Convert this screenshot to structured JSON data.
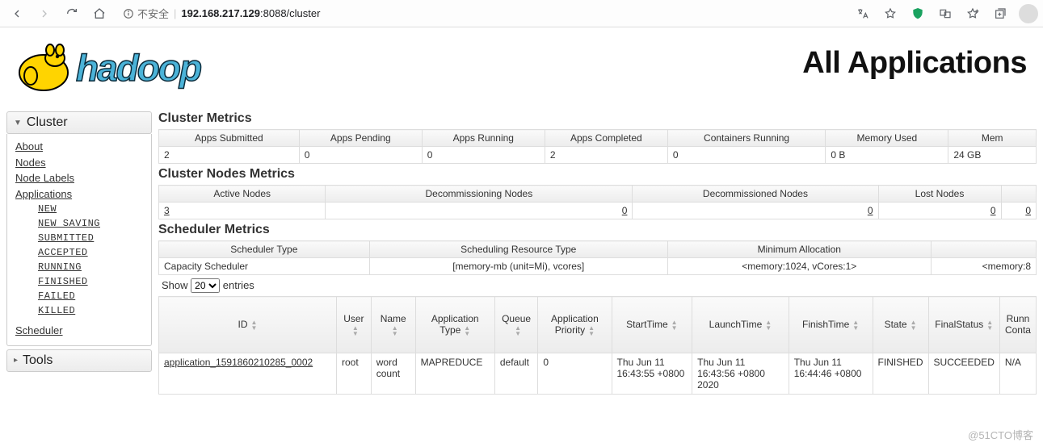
{
  "browser": {
    "insecure_label": "不安全",
    "url_host": "192.168.217.129",
    "url_rest": ":8088/cluster"
  },
  "header": {
    "title": "All Applications"
  },
  "sidebar": {
    "cluster_label": "Cluster",
    "tools_label": "Tools",
    "links": {
      "about": "About",
      "nodes": "Nodes",
      "node_labels": "Node Labels",
      "applications": "Applications",
      "scheduler": "Scheduler"
    },
    "app_states": {
      "new": "NEW",
      "new_saving": "NEW SAVING",
      "submitted": "SUBMITTED",
      "accepted": "ACCEPTED",
      "running": "RUNNING",
      "finished": "FINISHED",
      "failed": "FAILED",
      "killed": "KILLED"
    }
  },
  "sections": {
    "cluster_metrics": "Cluster Metrics",
    "cluster_nodes_metrics": "Cluster Nodes Metrics",
    "scheduler_metrics": "Scheduler Metrics"
  },
  "cluster_metrics": {
    "headers": {
      "c1": "Apps Submitted",
      "c2": "Apps Pending",
      "c3": "Apps Running",
      "c4": "Apps Completed",
      "c5": "Containers Running",
      "c6": "Memory Used",
      "c7": "Mem"
    },
    "row": {
      "c1": "2",
      "c2": "0",
      "c3": "0",
      "c4": "2",
      "c5": "0",
      "c6": "0 B",
      "c7": "24 GB"
    }
  },
  "nodes_metrics": {
    "headers": {
      "c1": "Active Nodes",
      "c2": "Decommissioning Nodes",
      "c3": "Decommissioned Nodes",
      "c4": "Lost Nodes",
      "c5": ""
    },
    "row": {
      "c1": "3",
      "c2": "0",
      "c3": "0",
      "c4": "0",
      "c5": "0"
    }
  },
  "scheduler_metrics": {
    "headers": {
      "c1": "Scheduler Type",
      "c2": "Scheduling Resource Type",
      "c3": "Minimum Allocation",
      "c4": ""
    },
    "row": {
      "c1": "Capacity Scheduler",
      "c2": "[memory-mb (unit=Mi), vcores]",
      "c3": "<memory:1024, vCores:1>",
      "c4": "<memory:8"
    }
  },
  "entries": {
    "show": "Show",
    "entries": "entries",
    "value": "20"
  },
  "apps_table": {
    "headers": {
      "id": "ID",
      "user": "User",
      "name": "Name",
      "apptype": "Application Type",
      "queue": "Queue",
      "priority": "Application Priority",
      "starttime": "StartTime",
      "launchtime": "LaunchTime",
      "finishtime": "FinishTime",
      "state": "State",
      "finalstatus": "FinalStatus",
      "running": "Runn\nConta"
    },
    "rows": [
      {
        "id": "application_1591860210285_0002",
        "user": "root",
        "name": "word count",
        "apptype": "MAPREDUCE",
        "queue": "default",
        "priority": "0",
        "starttime": "Thu Jun 11 16:43:55 +0800",
        "launchtime": "Thu Jun 11 16:43:56 +0800 2020",
        "finishtime": "Thu Jun 11 16:44:46 +0800",
        "state": "FINISHED",
        "finalstatus": "SUCCEEDED",
        "running": "N/A"
      }
    ]
  },
  "watermark": "@51CTO博客"
}
